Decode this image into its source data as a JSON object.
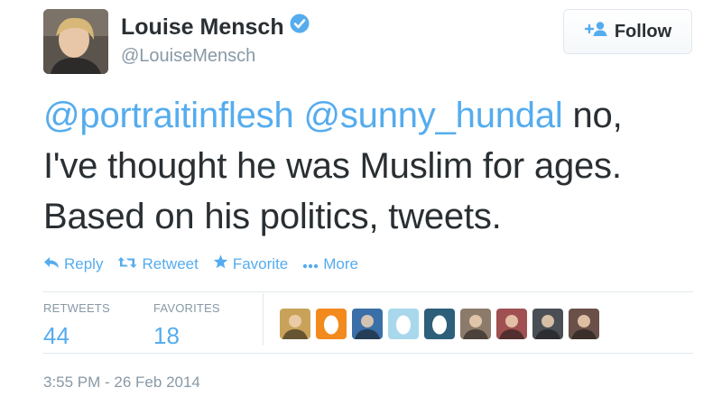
{
  "author": {
    "name": "Louise Mensch",
    "handle": "@LouiseMensch"
  },
  "follow_button": {
    "label": "Follow"
  },
  "tweet": {
    "mention_1": "@portraitinflesh",
    "mention_2": "@sunny_hundal",
    "text_line_1": " no,",
    "text_line_2": "I've thought he was Muslim for ages.",
    "text_line_3": "Based on his politics, tweets."
  },
  "actions": {
    "reply": "Reply",
    "retweet": "Retweet",
    "favorite": "Favorite",
    "more": "More"
  },
  "stats": {
    "retweets_label": "RETWEETS",
    "retweets_count": "44",
    "favorites_label": "FAVORITES",
    "favorites_count": "18"
  },
  "favorited_by": [
    {
      "kind": "photo",
      "color": "#c9a25a"
    },
    {
      "kind": "egg",
      "color": "#f28a1e"
    },
    {
      "kind": "photo",
      "color": "#3a6fa8"
    },
    {
      "kind": "egg",
      "color": "#a9d8ec"
    },
    {
      "kind": "egg",
      "color": "#2e5f7a"
    },
    {
      "kind": "photo",
      "color": "#8c7a6a"
    },
    {
      "kind": "photo",
      "color": "#a05050"
    },
    {
      "kind": "photo",
      "color": "#4a4f55"
    },
    {
      "kind": "photo",
      "color": "#6a5048"
    }
  ],
  "timestamp": "3:55 PM - 26 Feb 2014",
  "colors": {
    "link": "#55acee",
    "text": "#292f33",
    "muted": "#8899a6",
    "divider": "#e1e8ed"
  }
}
